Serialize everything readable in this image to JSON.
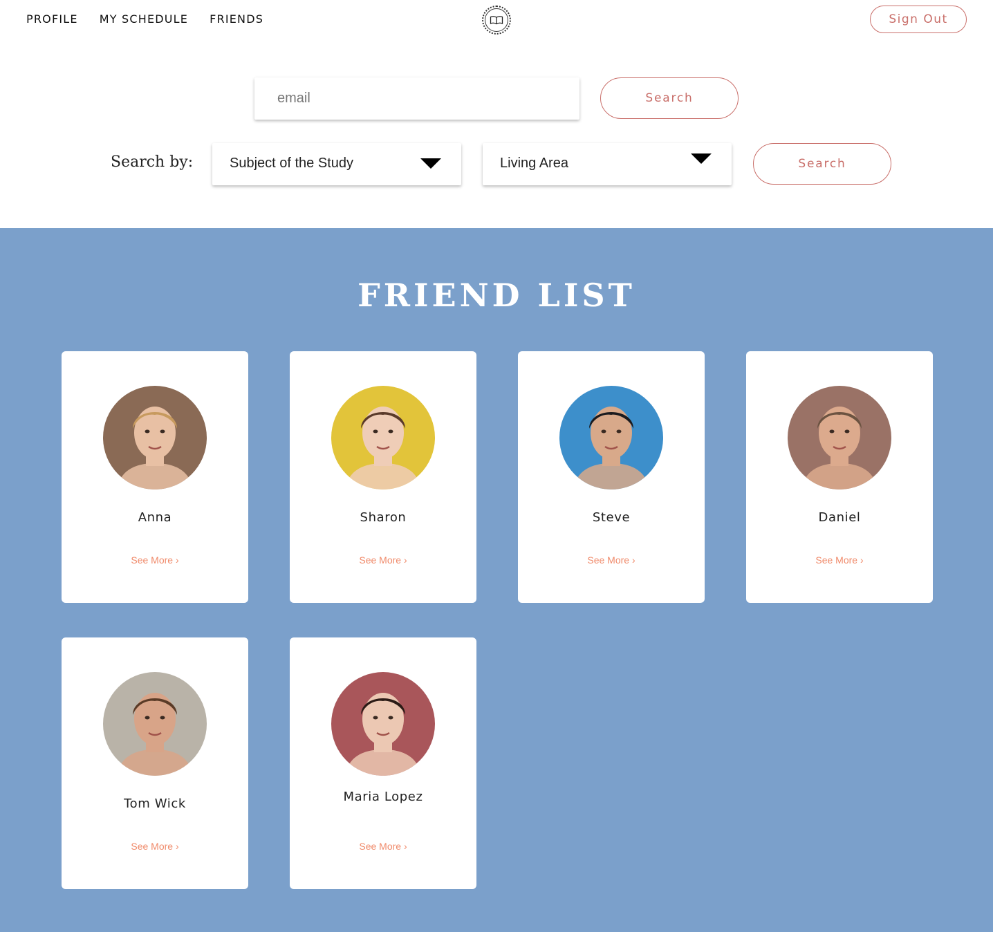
{
  "nav": {
    "links": [
      "PROFILE",
      "MY SCHEDULE",
      "FRIENDS"
    ],
    "logo_icon": "open-book-icon",
    "signout_label": "Sign Out"
  },
  "search": {
    "email_placeholder": "email",
    "email_value": "",
    "search_button_label": "Search",
    "search_by_label": "Search by:",
    "subject_select_value": "Subject of the Study",
    "area_select_value": "Living Area",
    "filter_search_button_label": "Search"
  },
  "friends": {
    "title": "FRIEND LIST",
    "see_more_label": "See More ›",
    "list": [
      {
        "name": "Anna",
        "avatar_bg": "#8a6a55",
        "hair": "#c79a5e",
        "skin": "#e8c0a4"
      },
      {
        "name": "Sharon",
        "avatar_bg": "#e2c43a",
        "hair": "#5a3a2a",
        "skin": "#efcdb7"
      },
      {
        "name": "Steve",
        "avatar_bg": "#3d8fcb",
        "hair": "#1b1b1f",
        "skin": "#d8a98a"
      },
      {
        "name": "Daniel",
        "avatar_bg": "#9a7266",
        "hair": "#6b5341",
        "skin": "#dcaa8d"
      },
      {
        "name": "Tom Wick",
        "avatar_bg": "#b9b3a8",
        "hair": "#5a3b27",
        "skin": "#d8a488"
      },
      {
        "name": "Maria Lopez",
        "avatar_bg": "#a9565a",
        "hair": "#2b1b16",
        "skin": "#ecc8b3"
      }
    ]
  },
  "colors": {
    "accent": "#c96f6a",
    "section_bg": "#7ba0cb",
    "see_more": "#f08a6a"
  }
}
